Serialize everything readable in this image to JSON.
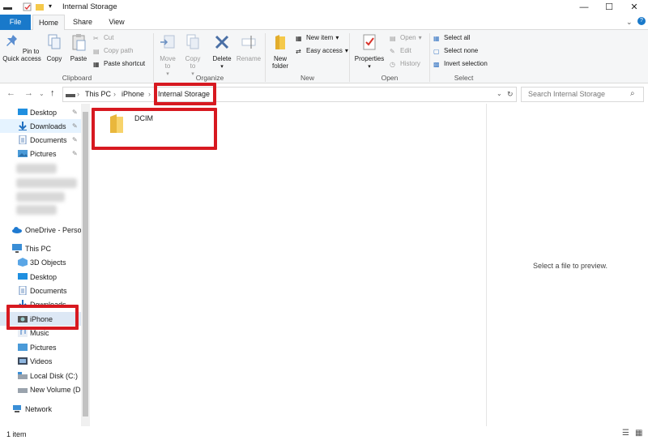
{
  "window": {
    "title": "Internal Storage",
    "controls": {
      "minimize": "—",
      "maximize": "☐",
      "close": "✕"
    }
  },
  "ribbon_tabs": [
    "File",
    "Home",
    "Share",
    "View"
  ],
  "ribbon": {
    "clipboard": {
      "label": "Clipboard",
      "pin": "Pin to Quick access",
      "copy": "Copy",
      "paste": "Paste",
      "cut": "Cut",
      "copy_path": "Copy path",
      "paste_shortcut": "Paste shortcut"
    },
    "organize": {
      "label": "Organize",
      "move_to": "Move to",
      "copy_to": "Copy to",
      "delete": "Delete",
      "rename": "Rename"
    },
    "new": {
      "label": "New",
      "new_folder": "New folder",
      "new_item": "New item",
      "easy_access": "Easy access"
    },
    "open": {
      "label": "Open",
      "properties": "Properties",
      "open": "Open",
      "edit": "Edit",
      "history": "History"
    },
    "select": {
      "label": "Select",
      "select_all": "Select all",
      "select_none": "Select none",
      "invert_selection": "Invert selection"
    }
  },
  "address": {
    "crumbs": [
      "This PC",
      "iPhone",
      "Internal Storage"
    ],
    "search_placeholder": "Search Internal Storage"
  },
  "nav": {
    "quick_access": [
      "Desktop",
      "Downloads",
      "Documents",
      "Pictures"
    ],
    "onedrive": "OneDrive - Person",
    "this_pc": "This PC",
    "pc_items": [
      "3D Objects",
      "Desktop",
      "Documents",
      "Downloads",
      "iPhone",
      "Music",
      "Pictures",
      "Videos",
      "Local Disk (C:)",
      "New Volume (D:)"
    ],
    "network": "Network"
  },
  "content": {
    "items": [
      {
        "name": "DCIM"
      }
    ]
  },
  "preview": {
    "message": "Select a file to preview."
  },
  "status": {
    "count": "1 item"
  },
  "colors": {
    "accent": "#1979ca",
    "highlight": "#d71920",
    "selected_bg": "#e5f3ff"
  }
}
